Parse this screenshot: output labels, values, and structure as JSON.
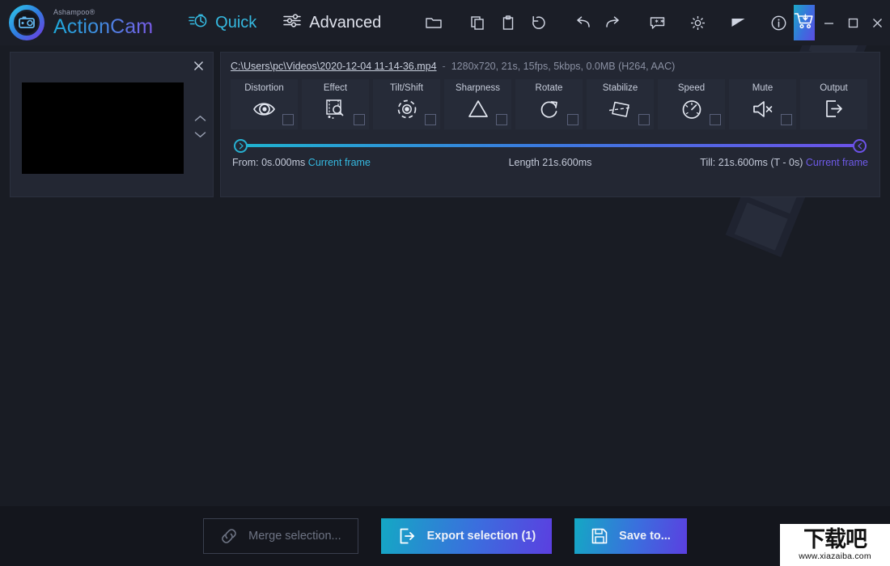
{
  "app": {
    "vendor": "Ashampoo®",
    "name": "ActionCam"
  },
  "modes": [
    {
      "label": "Quick",
      "icon": "stopwatch-icon",
      "active": true
    },
    {
      "label": "Advanced",
      "icon": "sliders-icon",
      "active": false
    }
  ],
  "toolbar": {
    "open_folder": "folder-icon",
    "copy": "copy-icon",
    "paste": "clipboard-icon",
    "reset": "reset-icon",
    "undo": "undo-icon",
    "redo": "redo-icon",
    "feedback": "feedback-icon",
    "settings": "gear-icon",
    "theme": "contrast-icon",
    "info": "info-icon",
    "buy": "cart-download-icon"
  },
  "window_controls": {
    "minimize": "−",
    "maximize": "□",
    "close": "✕"
  },
  "thumbnail": {
    "close": "✕",
    "move_up": "chevron-up-icon",
    "move_down": "chevron-down-icon"
  },
  "file": {
    "path": "C:\\Users\\pc\\Videos\\2020-12-04 11-14-36.mp4",
    "separator": "-",
    "meta": "1280x720, 21s, 15fps, 5kbps, 0.0MB (H264, AAC)"
  },
  "tools": [
    {
      "label": "Distortion",
      "icon": "distortion-eye-icon",
      "checkbox": true
    },
    {
      "label": "Effect",
      "icon": "effect-filmstrip-icon",
      "checkbox": true
    },
    {
      "label": "Tilt/Shift",
      "icon": "tiltshift-focus-icon",
      "checkbox": true
    },
    {
      "label": "Sharpness",
      "icon": "sharpness-triangle-icon",
      "checkbox": true
    },
    {
      "label": "Rotate",
      "icon": "rotate-icon",
      "checkbox": true
    },
    {
      "label": "Stabilize",
      "icon": "stabilize-icon",
      "checkbox": true
    },
    {
      "label": "Speed",
      "icon": "speed-gauge-icon",
      "checkbox": true
    },
    {
      "label": "Mute",
      "icon": "mute-speaker-icon",
      "checkbox": true
    },
    {
      "label": "Output",
      "icon": "output-export-icon",
      "checkbox": false
    }
  ],
  "timeline": {
    "from_label": "From: 0s.000ms",
    "from_link": "Current frame",
    "length_label": "Length  21s.600ms",
    "till_label": "Till: 21s.600ms (T - 0s)",
    "till_link": "Current frame",
    "start_percent": 0,
    "end_percent": 100,
    "gradient_start": "#1fb3cf",
    "gradient_end": "#6c52e8"
  },
  "footer": {
    "merge": "Merge selection...",
    "merge_icon": "link-chain-icon",
    "export": "Export selection (1)",
    "export_icon": "export-icon",
    "save": "Save to...",
    "save_icon": "floppy-save-icon"
  },
  "watermark": {
    "cn": "下载吧",
    "url": "www.xiazaiba.com"
  }
}
